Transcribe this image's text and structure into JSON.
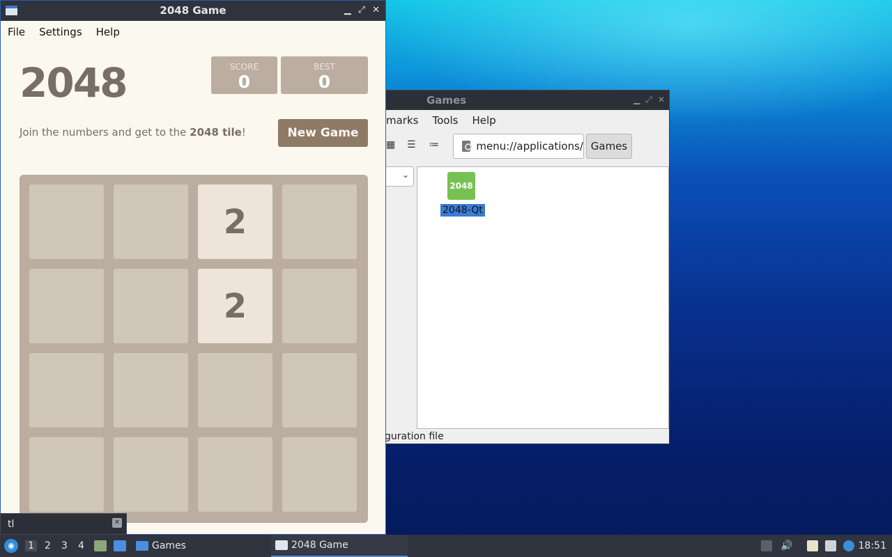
{
  "game_window": {
    "title": "2048 Game",
    "controls": {
      "minimize": "▁",
      "maximize": "⤢",
      "close": "✕"
    },
    "menu": [
      "File",
      "Settings",
      "Help"
    ],
    "logo": "2048",
    "score_label": "SCORE",
    "score_value": "0",
    "best_label": "BEST",
    "best_value": "0",
    "intro_text": "Join the numbers and get to the ",
    "intro_bold": "2048 tile",
    "intro_end": "!",
    "new_game_label": "New Game",
    "board": [
      [
        "",
        "",
        "2",
        ""
      ],
      [
        "",
        "",
        "2",
        ""
      ],
      [
        "",
        "",
        "",
        ""
      ],
      [
        "",
        "",
        "",
        ""
      ]
    ]
  },
  "file_manager": {
    "title": "Games",
    "menu": [
      "marks",
      "Tools",
      "Help"
    ],
    "path": "menu://applications/",
    "crumb": "Games",
    "file_icon_text": "2048",
    "file_label": "2048-Qt",
    "status": "guration file"
  },
  "search_popup": {
    "value": "tl"
  },
  "taskbar": {
    "workspaces": [
      "1",
      "2",
      "3",
      "4"
    ],
    "tasks": [
      {
        "label": "Games"
      },
      {
        "label": "2048 Game"
      }
    ],
    "clock": "18:51"
  },
  "colors": {
    "tile_board": "#bbada0",
    "tile_2": "#eee4da",
    "button": "#8f7a66",
    "selection": "#3c7bd3"
  }
}
